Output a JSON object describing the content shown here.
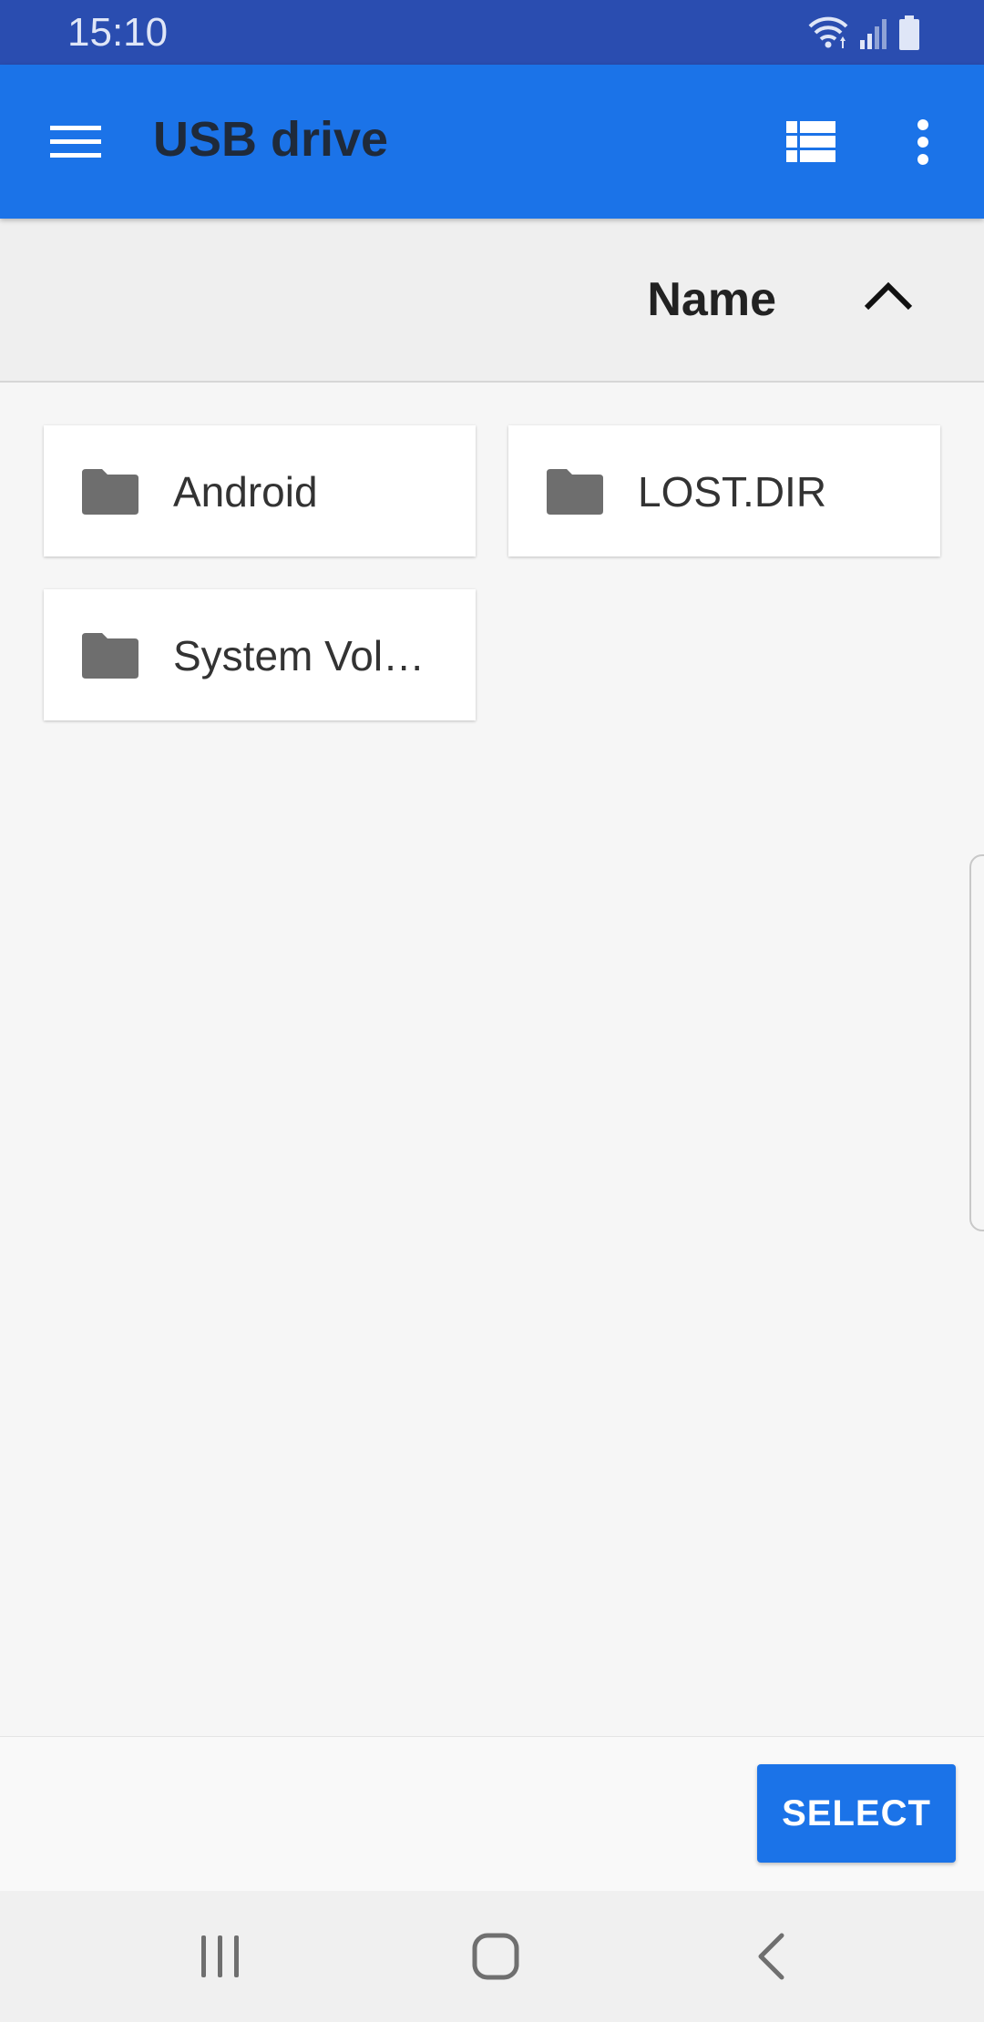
{
  "status_bar": {
    "time": "15:10",
    "icons": [
      "wifi-icon",
      "signal-icon",
      "battery-icon"
    ],
    "background": "#2a4db0"
  },
  "app_bar": {
    "title": "USB drive",
    "background": "#1b73e8",
    "icons": [
      "menu-icon",
      "list-view-icon",
      "more-vert-icon"
    ]
  },
  "sort_bar": {
    "label": "Name",
    "direction_icon": "chevron-up-icon"
  },
  "files": [
    {
      "name": "Android",
      "type": "folder"
    },
    {
      "name": "LOST.DIR",
      "type": "folder"
    },
    {
      "name": "System Vol…",
      "type": "folder"
    }
  ],
  "action_bar": {
    "select_label": "SELECT",
    "accent": "#1b73e8"
  },
  "nav_bar": {
    "icons": [
      "recents-icon",
      "home-icon",
      "back-icon"
    ]
  }
}
